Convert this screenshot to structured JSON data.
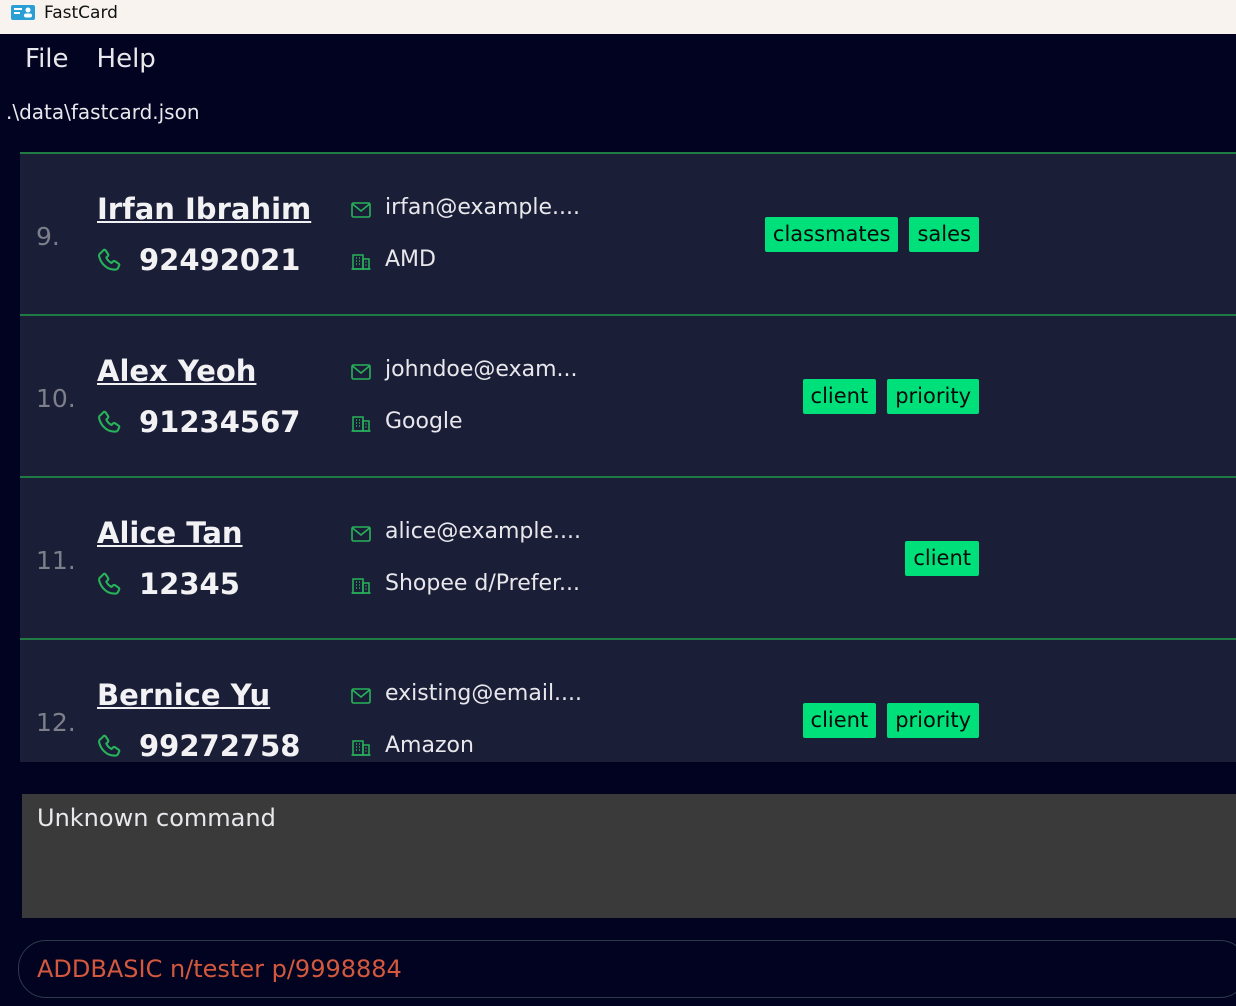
{
  "window": {
    "title": "FastCard"
  },
  "menu": [
    {
      "label": "File"
    },
    {
      "label": "Help"
    }
  ],
  "file_path": ".\\data\\fastcard.json",
  "colors": {
    "background": "#010320",
    "card": "#1b1e37",
    "tag": "#00e07a",
    "divider": "#1f7a43",
    "icon_green": "#27b35a",
    "command_text": "#d4583e"
  },
  "contacts": [
    {
      "index": "9.",
      "name": "Irfan Ibrahim",
      "phone": "92492021",
      "email": "irfan@example....",
      "company": "AMD",
      "tags": [
        "classmates",
        "sales"
      ]
    },
    {
      "index": "10.",
      "name": "Alex Yeoh",
      "phone": "91234567",
      "email": "johndoe@exam...",
      "company": "Google",
      "tags": [
        "client",
        "priority"
      ]
    },
    {
      "index": "11.",
      "name": "Alice Tan",
      "phone": "12345",
      "email": "alice@example....",
      "company": "Shopee d/Prefer...",
      "tags": [
        "client"
      ]
    },
    {
      "index": "12.",
      "name": "Bernice Yu",
      "phone": "99272758",
      "email": "existing@email....",
      "company": "Amazon",
      "tags": [
        "client",
        "priority"
      ]
    }
  ],
  "result_display": {
    "text": "Unknown command"
  },
  "command_box": {
    "value": "ADDBASIC n/tester p/9998884"
  }
}
